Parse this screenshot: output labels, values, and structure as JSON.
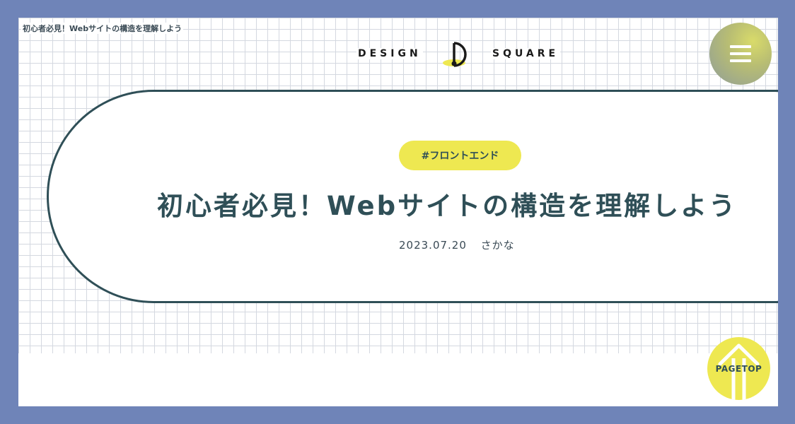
{
  "breadcrumb": "初心者必見！Webサイトの構造を理解しよう",
  "logo": {
    "left_text": "DESIGN",
    "right_text": "SQUARE"
  },
  "menu": {
    "icon": "hamburger-menu-icon"
  },
  "article": {
    "tag": "#フロントエンド",
    "title": "初心者必見！Webサイトの構造を理解しよう",
    "date": "2023.07.20",
    "author": "さかな"
  },
  "pagetop": {
    "label": "PAGETOP",
    "icon": "arrow-up-icon"
  },
  "colors": {
    "frame": "#6f84b8",
    "accent_yellow": "#eee851",
    "text_dark": "#2f4f57",
    "grid_line": "#d4d8e0"
  }
}
